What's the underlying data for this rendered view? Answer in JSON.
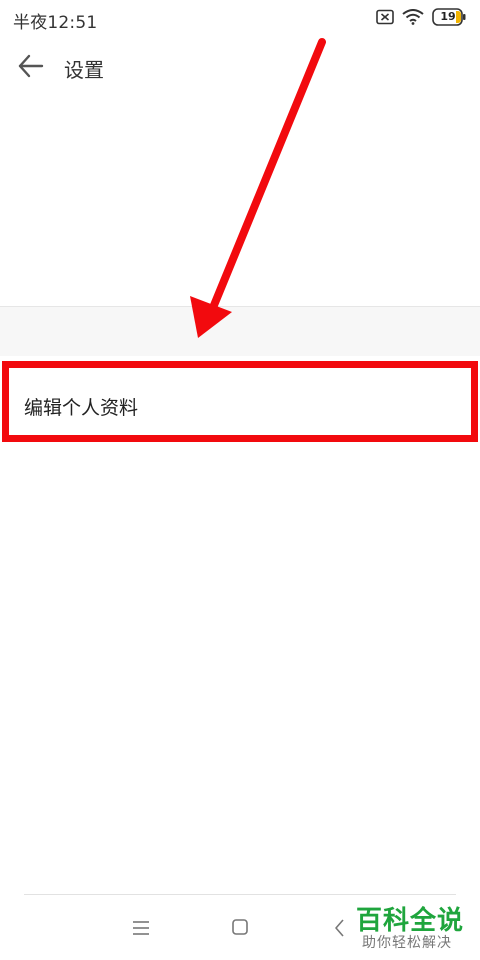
{
  "status_bar": {
    "time": "半夜12:51",
    "battery_level": "19",
    "icons": [
      "sim-disabled-icon",
      "wifi-icon",
      "battery-icon"
    ]
  },
  "app_bar": {
    "title": "设置",
    "back_icon": "arrow-left-icon"
  },
  "settings": {
    "items": [
      {
        "label": "编辑个人资料"
      }
    ]
  },
  "annotation": {
    "highlight_color": "#f20a0e",
    "arrow_color": "#f20a0e"
  },
  "nav_bar": {
    "buttons": [
      "menu-icon",
      "home-icon",
      "back-icon"
    ]
  },
  "watermark": {
    "title": "百科全说",
    "subtitle": "助你轻松解决"
  }
}
